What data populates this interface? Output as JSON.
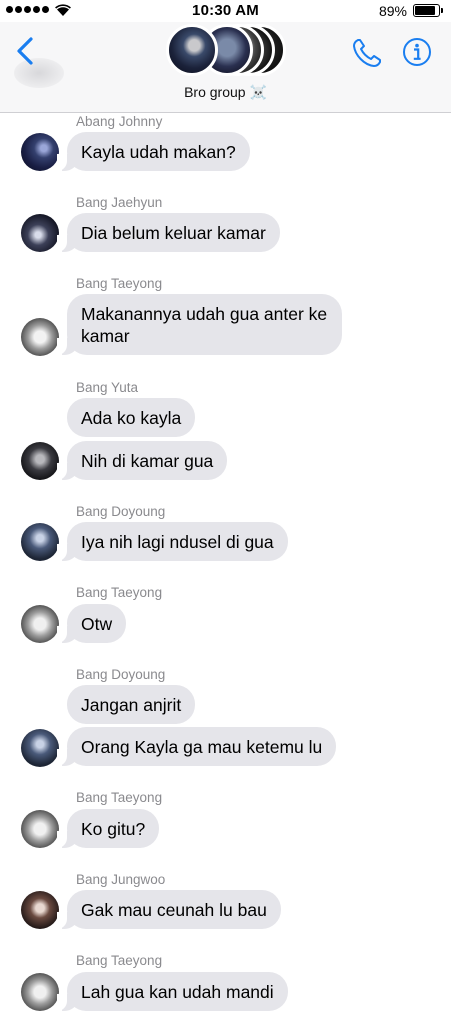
{
  "status_bar": {
    "time": "10:30 AM",
    "battery_percent": "89%",
    "battery_level": 0.89
  },
  "header": {
    "group_name": "Bro group",
    "group_emoji": "☠️",
    "accent_color": "#1a7ef0"
  },
  "messages": [
    {
      "sender": "Abang Johnny",
      "text": "Kayla udah makan?"
    },
    {
      "sender": "Bang Jaehyun",
      "text": "Dia belum keluar kamar"
    },
    {
      "sender": "Bang Taeyong",
      "text": "Makanannya udah gua anter ke kamar"
    },
    {
      "sender": "Bang Yuta",
      "text": "Ada ko kayla"
    },
    {
      "sender": "",
      "text": "Nih di kamar gua"
    },
    {
      "sender": "Bang Doyoung",
      "text": "Iya nih lagi ndusel di gua"
    },
    {
      "sender": "Bang Taeyong",
      "text": "Otw"
    },
    {
      "sender": "Bang Doyoung",
      "text": "Jangan anjrit"
    },
    {
      "sender": "",
      "text": "Orang Kayla ga mau ketemu lu"
    },
    {
      "sender": "Bang Taeyong",
      "text": "Ko gitu?"
    },
    {
      "sender": "Bang Jungwoo",
      "text": "Gak mau ceunah lu bau"
    },
    {
      "sender": "Bang Taeyong",
      "text": "Lah gua kan udah mandi"
    }
  ],
  "colors": {
    "bubble": "#e5e5ea",
    "sender_label": "#8a8a8e",
    "header_bg": "#f7f7f8"
  }
}
